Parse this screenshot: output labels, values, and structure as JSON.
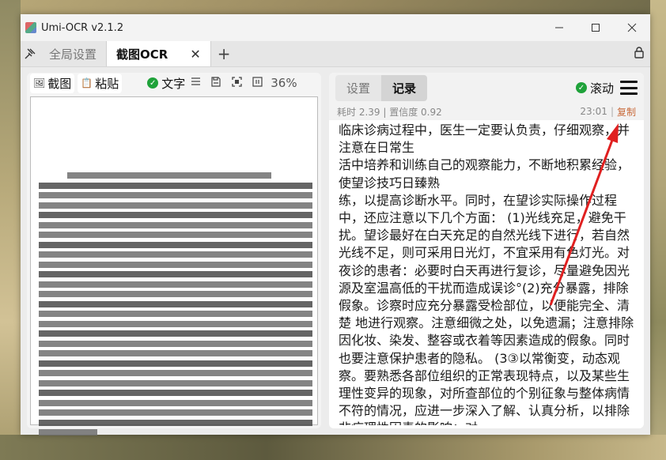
{
  "window": {
    "title": "Umi-OCR v2.1.2",
    "minimize": "—",
    "maximize": "☐",
    "close": "✕"
  },
  "tabs": {
    "pin_icon": "pin-icon",
    "items": [
      {
        "label": "全局设置",
        "active": false
      },
      {
        "label": "截图OCR",
        "active": true
      }
    ],
    "close": "✕",
    "add": "+",
    "lock_icon": "lock-icon"
  },
  "left_toolbar": {
    "screenshot": "截图",
    "paste": "粘贴",
    "text_toggle": "文字",
    "zoom": "36%",
    "icons": [
      "list-icon",
      "save-icon",
      "fit-icon",
      "original-size-icon"
    ]
  },
  "right_panel": {
    "tabs": [
      "设置",
      "记录"
    ],
    "active_tab": "记录",
    "scroll_label": "滚动",
    "meta_left": "耗时 2.39 | 置信度 0.92",
    "time": "23:01",
    "copy": "复制",
    "result_text": "临床诊病过程中，医生一定要认负责，仔细观察，并注意在日常生\n活中培养和训练自己的观察能力，不断地积累经验，使望诊技巧日臻熟\n练，以提高诊断水平。同时，在望诊实际操作过程中，还应注意以下几个方面：  (1)光线充足，避免干扰。望诊最好在白天充足的自然光线下进行，若自然光线不足，则可采用日光灯，不宜采用有色灯光。对夜诊的患者：必要时白天再进行复诊，尽量避免因光源及室温高低的干扰而造成误诊°(2)充分暴露，排除假象。诊察时应充分暴露受检部位，以便能完全、清楚  地进行观察。注意细微之处，以免遗漏；注意排除因化妆、染发、整容或衣着等因素造成的假象。同时也要注意保护患者的隐私。  (3③以常衡变，动态观察。要熟悉各部位组织的正常表现特点，以及某些生理性变异的现象，对所查部位的个别征象与整体病情不符的情况，应进一步深入了解、认真分析，以排除非病理性因素的影响；对"
  },
  "colors": {
    "accent_green": "#1fa23a",
    "copy_link": "#c86a3a",
    "arrow": "#e02020"
  }
}
